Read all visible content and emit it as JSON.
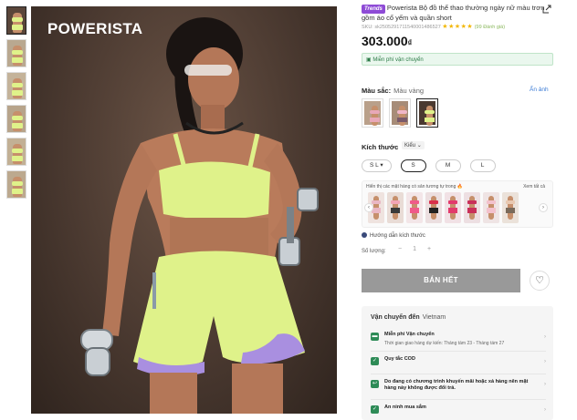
{
  "brand": "POWERISTA",
  "product": {
    "trend_badge": "Trends",
    "title": "Powerista Bộ đồ thể thao thường ngày nữ màu trơn gồm áo cổ yếm và quần short",
    "sku": "SKU: sk2505291711540001486527",
    "stars": "★★★★★",
    "reviews": "(99 Đánh giá)",
    "price_value": "303.000",
    "price_currency": "₫",
    "free_ship_banner": "Miễn phí vận chuyển"
  },
  "color": {
    "label": "Màu sắc:",
    "selected": "Màu vàng",
    "hide_images": "Ẩn ảnh",
    "swatches": [
      {
        "top": "#e8a8b8",
        "bottom": "#e8a8b8",
        "bg": "#b9a08a"
      },
      {
        "top": "#f0b6c8",
        "bottom": "#7a5a6a",
        "bg": "#a78c78"
      },
      {
        "top": "#dff28a",
        "bottom": "#dff28a",
        "bg": "#4a3930"
      }
    ]
  },
  "size": {
    "label": "Kích thước",
    "type": "Kiểu",
    "options": [
      "S L",
      "S",
      "M",
      "L"
    ]
  },
  "similar": {
    "title": "Hiển thị các mặt hàng có sản tương tự trong ",
    "more": "Xem tất cả",
    "items": [
      {
        "top": "#e9b7c4",
        "bottom": "#e9b7c4",
        "bg": "#efe3df"
      },
      {
        "top": "#f2a5b6",
        "bottom": "#3a3a3a",
        "bg": "#e9dcd6"
      },
      {
        "top": "#f05a8a",
        "bottom": "#f05a8a",
        "bg": "#f3e6e8"
      },
      {
        "top": "#d9304c",
        "bottom": "#222222",
        "bg": "#ecdfe0"
      },
      {
        "top": "#e23a6c",
        "bottom": "#e23a6c",
        "bg": "#f1e1e5"
      },
      {
        "top": "#c9305a",
        "bottom": "#c9305a",
        "bg": "#eddfe2"
      },
      {
        "top": "#f3c1cc",
        "bottom": "#f3c1cc",
        "bg": "#efe4e4"
      },
      {
        "top": "#e8c8b0",
        "bottom": "#7a6a5a",
        "bg": "#ebe2da"
      }
    ]
  },
  "size_guide": "Hướng dẫn kích thước",
  "quantity": {
    "label": "Số lượng:",
    "value": "1",
    "minus": "−",
    "plus": "+"
  },
  "sold_out": "BÁN HẾT",
  "shipping": {
    "head": "Vận chuyển đến",
    "country": "Vietnam",
    "rows": [
      {
        "title": "Miễn phí Vận chuyển",
        "sub": "Thời gian giao hàng dự kiến: Tháng tám 23 - Tháng tám 27",
        "icon": "truck-icon",
        "glyph": "▬"
      },
      {
        "title": "Quy tắc COD",
        "sub": "",
        "icon": "shield-check-icon",
        "glyph": "✓"
      },
      {
        "title": "Do đang có chương trình khuyến mãi hoặc xả hàng nên mặt hàng này không được đổi trả.",
        "sub": "",
        "icon": "return-icon",
        "glyph": "↩"
      },
      {
        "title": "An ninh mua sắm",
        "sub": "",
        "icon": "secure-icon",
        "glyph": "✓"
      }
    ]
  },
  "thumbnails": [
    {
      "bg": "#5a463a"
    },
    {
      "bg": "#b9a890"
    },
    {
      "bg": "#c4b39a"
    },
    {
      "bg": "#b7a48b"
    },
    {
      "bg": "#c2b095"
    },
    {
      "bg": "#bca98f"
    }
  ]
}
